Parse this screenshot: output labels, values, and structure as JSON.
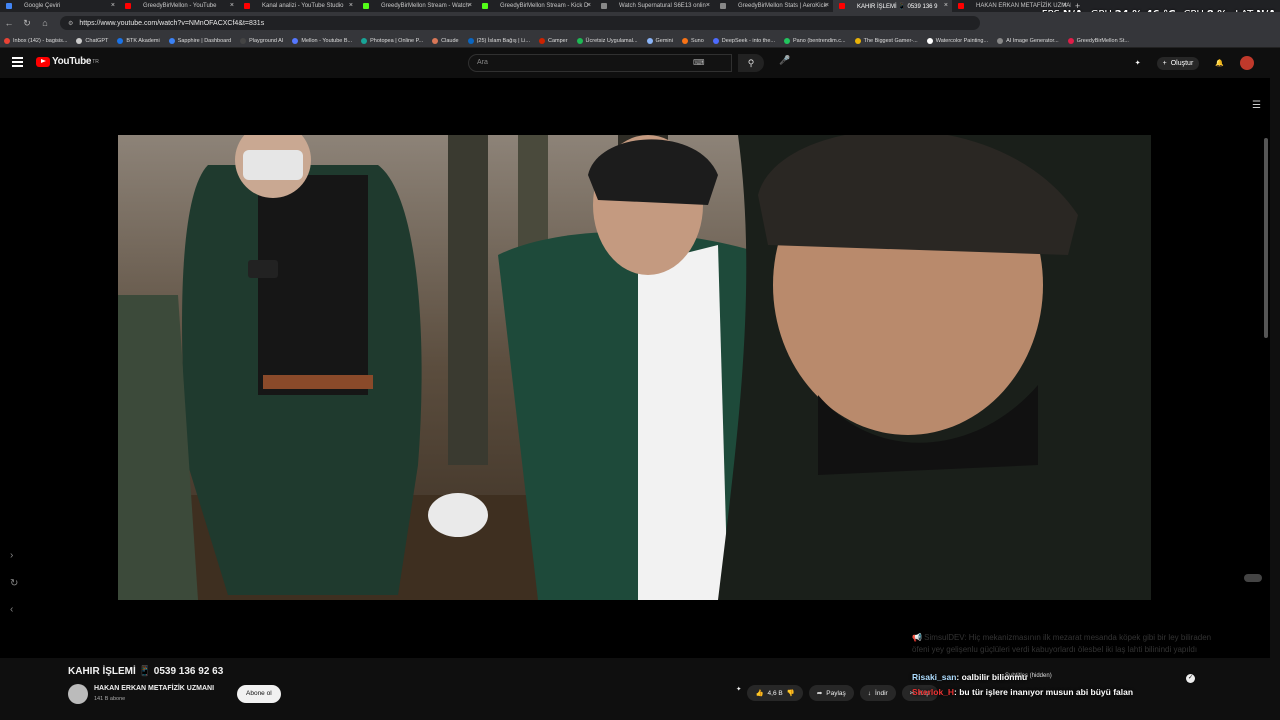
{
  "browser": {
    "tabs": [
      {
        "label": "Google Çeviri",
        "color": "#4285f4"
      },
      {
        "label": "GreedyBirMellon - YouTube",
        "color": "#ff0000"
      },
      {
        "label": "Kanal analizi - YouTube Studio",
        "color": "#ff0000"
      },
      {
        "label": "GreedyBirMellon Stream - Watch",
        "color": "#53fc18"
      },
      {
        "label": "GreedyBirMellon Stream - Kick D",
        "color": "#53fc18"
      },
      {
        "label": "Watch Supernatural S6E13 onlin",
        "color": "#888888"
      },
      {
        "label": "GreedyBirMellon Stats | AeroKick",
        "color": "#888888"
      },
      {
        "label": "KAHIR İŞLEMİ 📱 0539 136 9",
        "color": "#ff0000"
      },
      {
        "label": "HAKAN ERKAN METAFİZİK UZMAN",
        "color": "#ff0000"
      }
    ],
    "new_tab": "+",
    "url": "https://www.youtube.com/watch?v=NMnOFACXCf4&t=831s",
    "bookmarks": [
      {
        "label": "Inbox (142) - bagisis...",
        "color": "#ea4335"
      },
      {
        "label": "ChatGPT",
        "color": "#cccccc"
      },
      {
        "label": "BTK Akademi",
        "color": "#1a73e8"
      },
      {
        "label": "Sapphire | Dashboard",
        "color": "#3b82f6"
      },
      {
        "label": "Playground AI",
        "color": "#444444"
      },
      {
        "label": "Mellon - Youtube B...",
        "color": "#5577ff"
      },
      {
        "label": "Photopea | Online P...",
        "color": "#18a497"
      },
      {
        "label": "Claude",
        "color": "#d97757"
      },
      {
        "label": "(25) İslam Bağış | Li...",
        "color": "#0a66c2"
      },
      {
        "label": "Camper",
        "color": "#cc2200"
      },
      {
        "label": "Ücretsiz Uygulamal...",
        "color": "#1db954"
      },
      {
        "label": "Gemini",
        "color": "#8ab4f8"
      },
      {
        "label": "Suno",
        "color": "#f97316"
      },
      {
        "label": "DeepSeek - into the...",
        "color": "#4d6bfe"
      },
      {
        "label": "Pano (bentrendim.c...",
        "color": "#22c55e"
      },
      {
        "label": "The Biggest Gamer-...",
        "color": "#eab308"
      },
      {
        "label": "Watercolor Painting...",
        "color": "#ffffff"
      },
      {
        "label": "AI Image Generator...",
        "color": "#888888"
      },
      {
        "label": "GreedyBirMellon St...",
        "color": "#e11d48"
      }
    ]
  },
  "hud": {
    "fps_label": "FPS",
    "fps_value": "N/A",
    "gpu_label": "GPU",
    "gpu_value": "24 % 46 °C",
    "cpu_label": "CPU",
    "cpu_value": "8 %",
    "lat_label": "LAT",
    "lat_value": "N/A"
  },
  "youtube": {
    "logo_text": "YouTube",
    "region": "TR",
    "search_placeholder": "Ara",
    "create_label": "Oluştur"
  },
  "video": {
    "title": "KAHIR İŞLEMİ 📱 0539 136 92 63",
    "channel": "HAKAN ERKAN  METAFİZİK UZMANI",
    "subscribers": "141 B abone",
    "subscribe_label": "Abone ol",
    "likes": "4,6 B",
    "share_label": "Paylaş",
    "download_label": "İndir",
    "clip_label": "Klip"
  },
  "chat": {
    "faded_line": "📢 SimsulDEV: Hiç mekanizmasının ilk mezarat mesanda köpek gibi bir ley biliraden öfeni yey gelişenlu güçlüleri verdi kabuyorlardı ölesbel iki laş lahti bilinindi yapıldı",
    "subtitles_label": "Subtitles (hidden)",
    "messages": [
      {
        "user": "Risaki_san",
        "text": ": oalbilir bilionmu"
      },
      {
        "user": "Sherlok_H",
        "text": ": bu tür işlere inanıyor musun abi büyü falan"
      }
    ]
  }
}
